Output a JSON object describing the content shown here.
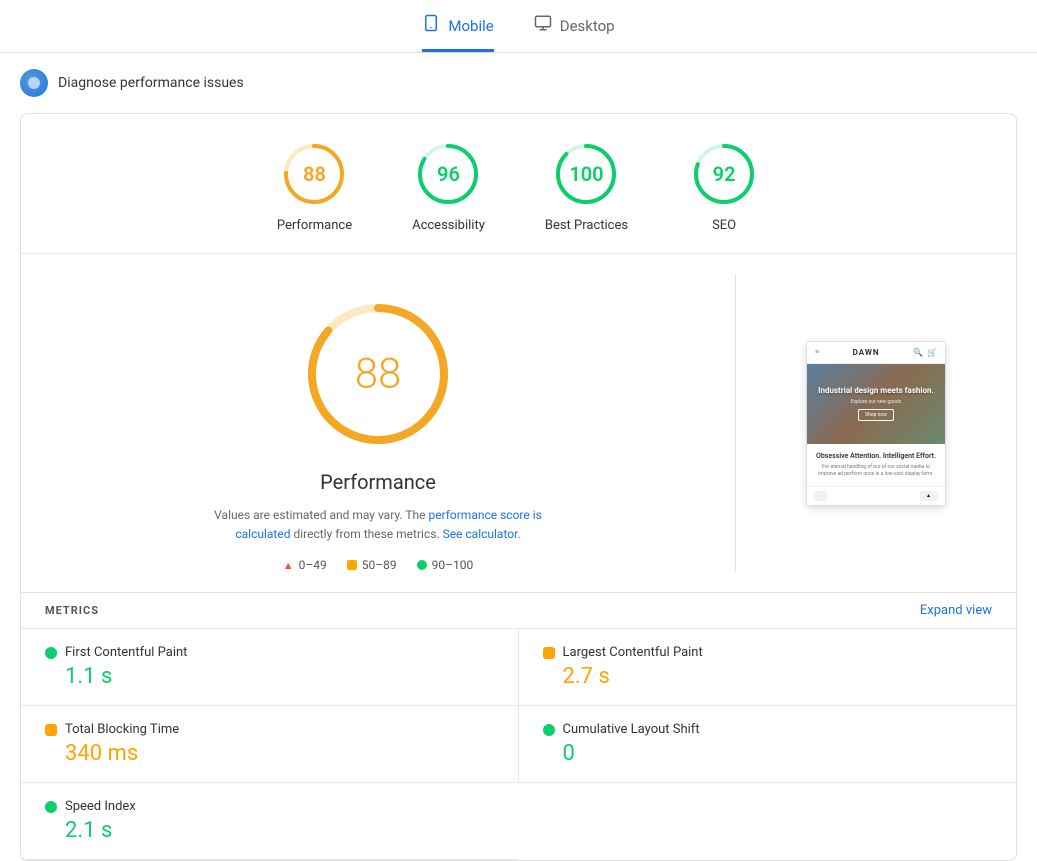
{
  "tabs": [
    {
      "id": "mobile",
      "label": "Mobile",
      "active": true
    },
    {
      "id": "desktop",
      "label": "Desktop",
      "active": false
    }
  ],
  "diagnose": {
    "text": "Diagnose performance issues"
  },
  "scores": [
    {
      "id": "performance",
      "value": 88,
      "label": "Performance",
      "color": "#f4a723",
      "track": "#fce8c3",
      "radius": 28
    },
    {
      "id": "accessibility",
      "value": 96,
      "label": "Accessibility",
      "color": "#0cce6b",
      "track": "#d4f5e4",
      "radius": 28
    },
    {
      "id": "best-practices",
      "value": 100,
      "label": "Best Practices",
      "color": "#0cce6b",
      "track": "#d4f5e4",
      "radius": 28
    },
    {
      "id": "seo",
      "value": 92,
      "label": "SEO",
      "color": "#0cce6b",
      "track": "#d4f5e4",
      "radius": 28
    }
  ],
  "detail": {
    "big_score": 88,
    "title": "Performance",
    "desc1": "Values are estimated and may vary. The ",
    "link1": "performance score is calculated",
    "desc2": " directly from these metrics. ",
    "link2": "See calculator",
    "desc3": "."
  },
  "legend": [
    {
      "id": "red",
      "type": "triangle",
      "range": "0–49"
    },
    {
      "id": "orange",
      "type": "square",
      "range": "50–89"
    },
    {
      "id": "green",
      "type": "circle",
      "range": "90–100"
    }
  ],
  "preview": {
    "site_name": "DAWN",
    "hero_title": "Industrial design meets fashion.",
    "hero_sub": "Explore our new goods",
    "hero_btn": "Shop now",
    "body_title": "Obsessive Attention. Intelligent Effort.",
    "body_text": "For eternal handling of our of our social media\nto improve ad perform once in a low-cost display\nform."
  },
  "metrics_section": {
    "label": "METRICS",
    "expand_label": "Expand view"
  },
  "metrics": [
    {
      "id": "fcp",
      "name": "First Contentful Paint",
      "value": "1.1 s",
      "color_type": "green"
    },
    {
      "id": "lcp",
      "name": "Largest Contentful Paint",
      "value": "2.7 s",
      "color_type": "orange"
    },
    {
      "id": "tbt",
      "name": "Total Blocking Time",
      "value": "340 ms",
      "color_type": "orange"
    },
    {
      "id": "cls",
      "name": "Cumulative Layout Shift",
      "value": "0",
      "color_type": "green"
    },
    {
      "id": "si",
      "name": "Speed Index",
      "value": "2.1 s",
      "color_type": "green"
    }
  ]
}
